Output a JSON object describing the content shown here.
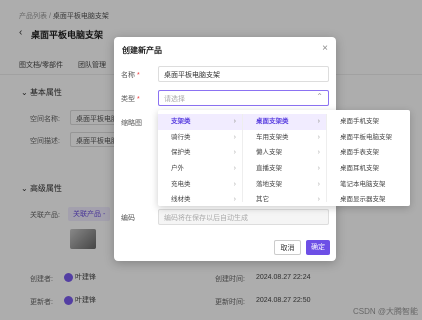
{
  "background": {
    "breadcrumb": {
      "parent": "产品列表",
      "sep": "/",
      "current": "桌面平板电脑支架"
    },
    "title": "桌面平板电脑支架",
    "tabs": [
      "图文档/零部件",
      "团队管理"
    ],
    "section_basic": "基本属性",
    "basic_fields": [
      {
        "label": "空间名称:",
        "value": "桌面平板电脑支"
      },
      {
        "label": "空间描述:",
        "value": "桌面平板电脑支"
      }
    ],
    "section_advanced": "高级属性",
    "related_label": "关联产品:",
    "related_tag": "关联产品 -",
    "creator_label": "创建者:",
    "creator_name": "叶建锋",
    "updater_label": "更新者:",
    "updater_name": "叶建锋",
    "created_time_label": "创建时间:",
    "created_time": "2024.08.27 22:24",
    "updated_time_label": "更新时间:",
    "updated_time": "2024.08.27 22:50"
  },
  "modal": {
    "title": "创建新产品",
    "close_icon": "close-icon",
    "name_label": "名称",
    "name_value": "桌面平板电脑支架",
    "type_label": "类型",
    "type_placeholder": "请选择",
    "thumb_label": "缩略图",
    "code_label": "编码",
    "code_placeholder": "编码将在保存以后自动生成",
    "cancel_label": "取消",
    "ok_label": "确定"
  },
  "cascader": {
    "col1": [
      "支架类",
      "骑行类",
      "保护类",
      "户外",
      "充电类",
      "线材类"
    ],
    "col2": [
      "桌面支架类",
      "车用支架类",
      "懒人支架",
      "直播支架",
      "落地支架",
      "其它"
    ],
    "col3": [
      "桌面手机支架",
      "桌面平板电脑支架",
      "桌面手表支架",
      "桌面耳机支架",
      "笔记本电脑支架",
      "桌面显示器支架"
    ],
    "active_col1": 0,
    "active_col2": 0
  },
  "accent_color": "#6d4fe6",
  "watermark": "CSDN @大腾智能",
  "required_mark": "*",
  "arrow_glyph": "›",
  "required_note": "*"
}
